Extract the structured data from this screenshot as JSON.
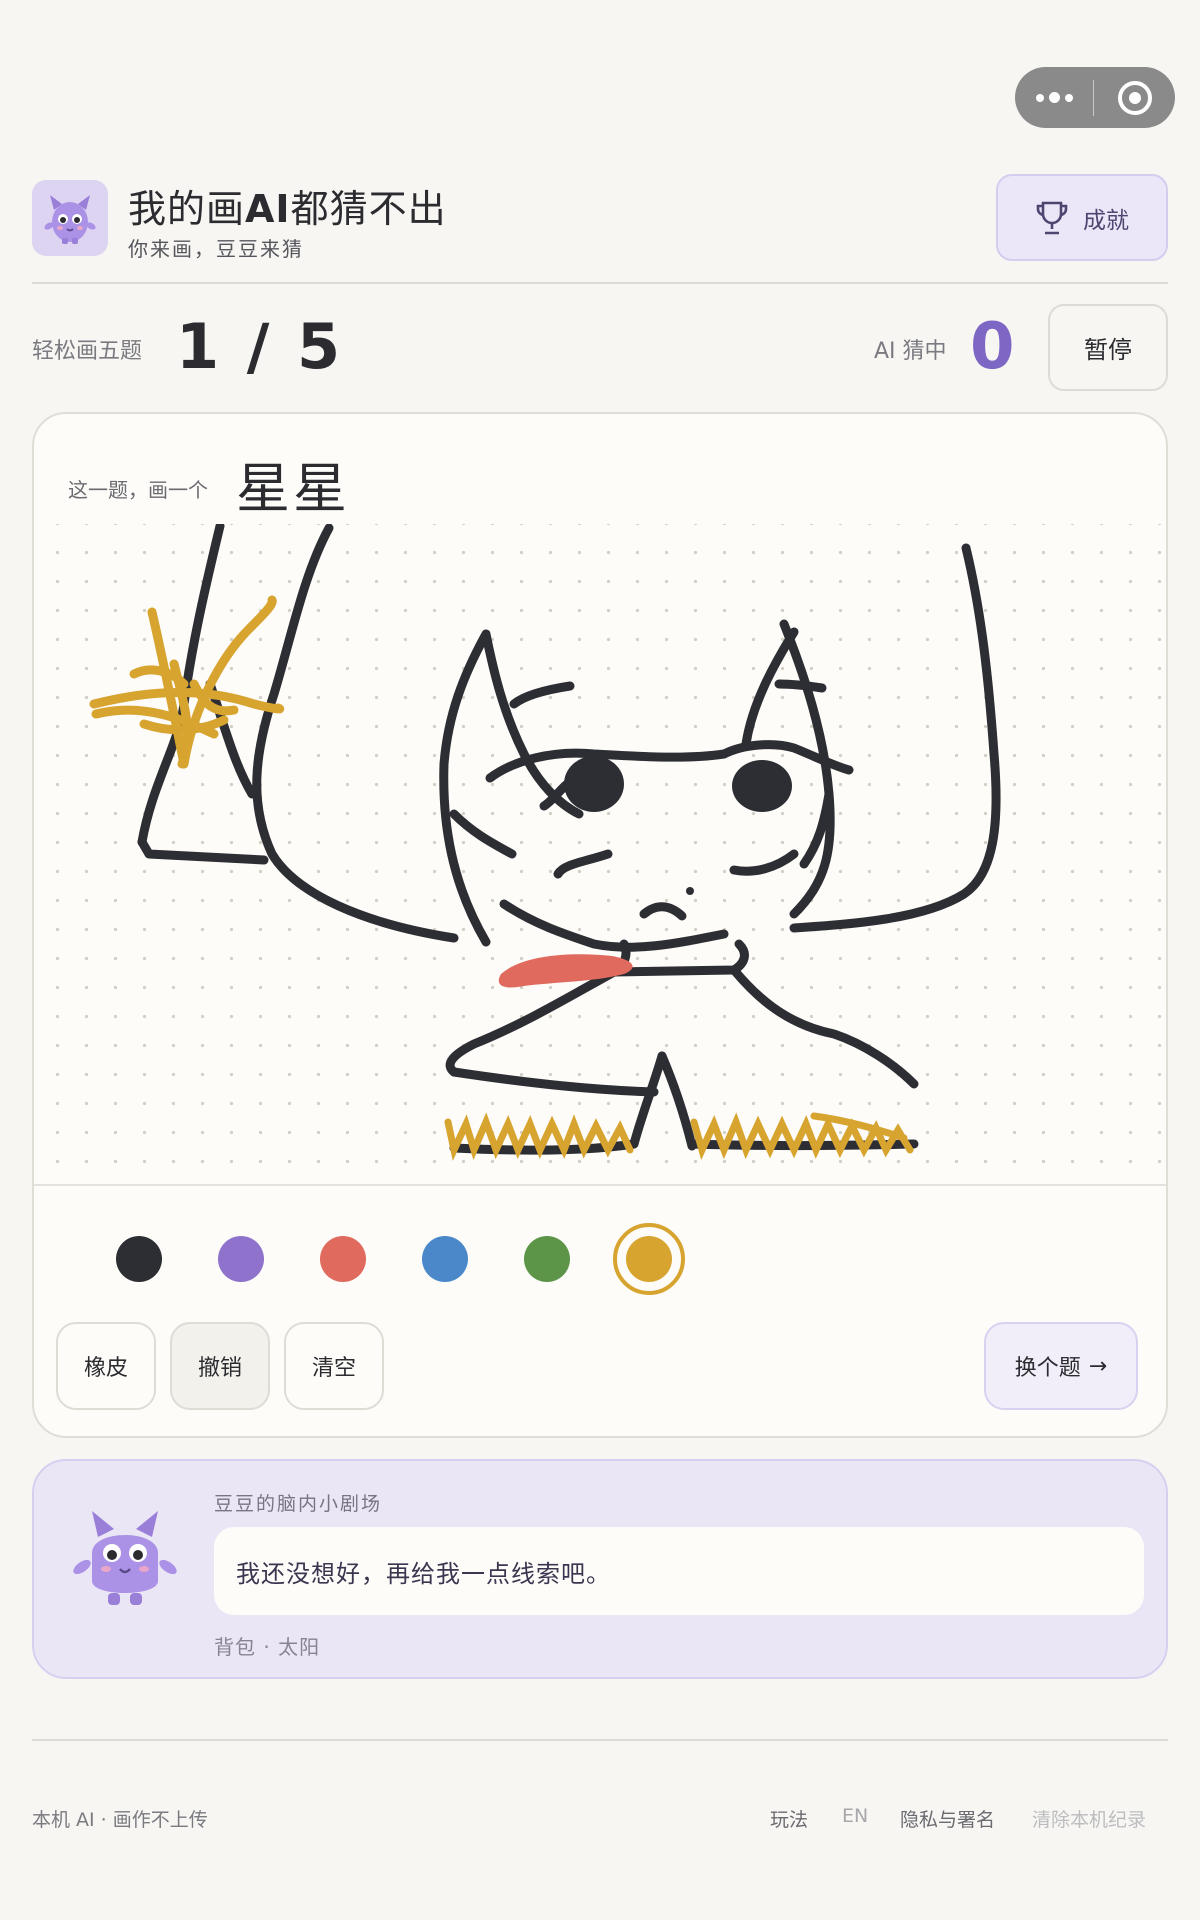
{
  "header": {
    "title_prefix": "我的画",
    "title_bold": "AI",
    "title_suffix": "都猜不出",
    "subtitle": "你来画，豆豆来猜",
    "achievements_label": "成就"
  },
  "status": {
    "mode_label": "轻松画五题",
    "progress": "1 / 5",
    "ai_label": "AI 猜中",
    "ai_score": "0",
    "pause_label": "暂停"
  },
  "prompt": {
    "prefix": "这一题，画一个",
    "word": "星星"
  },
  "palette": {
    "colors": [
      "#2d2e33",
      "#8e72cc",
      "#e06a5e",
      "#4a88c9",
      "#5c9448",
      "#d8a430"
    ],
    "selected_index": 5
  },
  "tools": {
    "eraser": "橡皮",
    "undo": "撤销",
    "clear": "清空",
    "next": "换个题",
    "next_arrow": "→"
  },
  "thought": {
    "label": "豆豆的脑内小剧场",
    "message": "我还没想好，再给我一点线索吧。",
    "inventory": "背包 · 太阳"
  },
  "footer": {
    "left": "本机 AI · 画作不上传",
    "links": [
      "玩法",
      "EN",
      "隐私与署名",
      "清除本机纪录"
    ]
  }
}
